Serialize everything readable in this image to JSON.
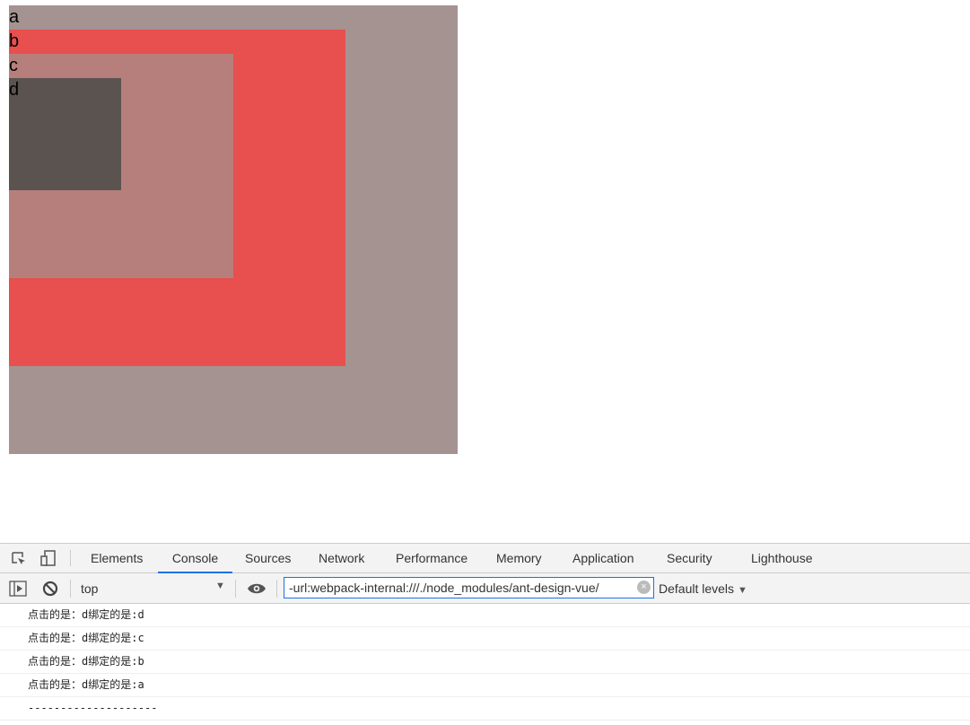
{
  "boxes": {
    "a": "a",
    "b": "b",
    "c": "c",
    "d": "d"
  },
  "colors": {
    "a": "#a59391",
    "b": "#e84f4f",
    "c": "#b77f7c",
    "d": "#5b5350",
    "accent": "#1a73e8"
  },
  "devtools": {
    "tabs": [
      "Elements",
      "Console",
      "Sources",
      "Network",
      "Performance",
      "Memory",
      "Application",
      "Security",
      "Lighthouse"
    ],
    "active_tab": "Console",
    "context": "top",
    "filter_value": "-url:webpack-internal:///./node_modules/ant-design-vue/",
    "levels": "Default levels",
    "messages": [
      "点击的是：d绑定的是:d",
      "点击的是：d绑定的是:c",
      "点击的是：d绑定的是:b",
      "点击的是：d绑定的是:a",
      "--------------------"
    ]
  }
}
